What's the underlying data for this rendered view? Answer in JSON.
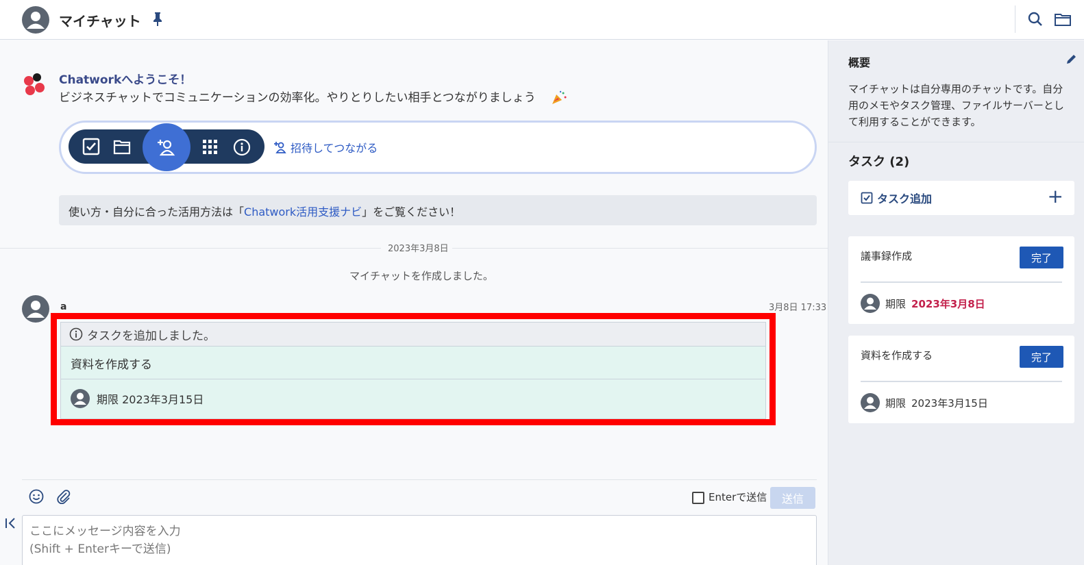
{
  "header": {
    "title": "マイチャット"
  },
  "welcome": {
    "title": "Chatworkへようこそ！",
    "text": "ビジネスチャットでコミュニケーションの効率化。やりとりしたい相手とつながりましょう",
    "invite_link": "招待してつながる",
    "navi_prefix": "使い方・自分に合った活用方法は「",
    "navi_link": "Chatwork活用支援ナビ",
    "navi_suffix": "」をご覧ください！"
  },
  "timeline": {
    "date_label": "2023年3月8日",
    "system_message": "マイチャットを作成しました。"
  },
  "message": {
    "sender": "a",
    "time": "3月8日 17:33",
    "task_header": "タスクを追加しました。",
    "task_body": "資料を作成する",
    "task_due": "期限 2023年3月15日"
  },
  "composer": {
    "enter_label": "Enterで送信",
    "send_label": "送信",
    "placeholder_line1": "ここにメッセージ内容を入力",
    "placeholder_line2": "(Shift + Enterキーで送信)"
  },
  "sidebar": {
    "overview_title": "概要",
    "overview_desc": "マイチャットは自分専用のチャットです。自分用のメモやタスク管理、ファイルサーバーとして利用することができます。",
    "tasks_title": "タスク (2)",
    "add_task_label": "タスク追加",
    "tasks": [
      {
        "name": "議事録作成",
        "done_label": "完了",
        "due_prefix": "期限",
        "due_date": "2023年3月8日"
      },
      {
        "name": "資料を作成する",
        "done_label": "完了",
        "due_prefix": "期限",
        "due_date": "2023年3月15日"
      }
    ]
  },
  "colors": {
    "accent": "#1e58b5",
    "highlight": "#ff0000",
    "overdue": "#c3214c"
  }
}
